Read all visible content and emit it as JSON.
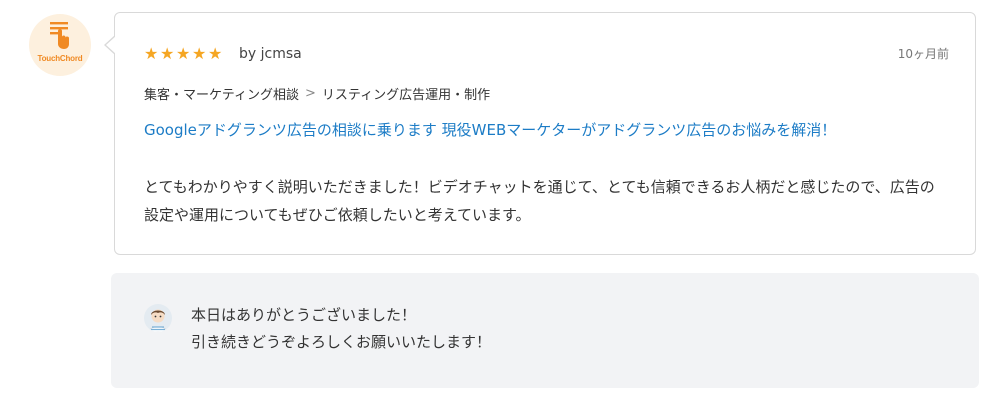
{
  "reviewer": {
    "avatar_icon": "touchchord-hand-icon",
    "avatar_label": "TouchChord"
  },
  "review": {
    "rating": 5,
    "rating_max": 5,
    "star_color": "#f5a623",
    "by_text": "by jcmsa",
    "date": "10ヶ月前",
    "breadcrumb": {
      "category": "集客・マーケティング相談",
      "separator": ">",
      "subcategory": "リスティング広告運用・制作"
    },
    "service_title": "Googleアドグランツ広告の相談に乗ります 現役WEBマーケターがアドグランツ広告のお悩みを解消！",
    "service_title_color": "#1c7cc6",
    "comment": "とてもわかりやすく説明いただきました！ビデオチャットを通じて、とても信頼できるお人柄だと感じたので、広告の設定や運用についてもぜひご依頼したいと考えています。"
  },
  "reply": {
    "avatar_icon": "seller-avatar-icon",
    "line1": "本日はありがとうございました！",
    "line2": "引き続きどうぞよろしくお願いいたします！"
  }
}
